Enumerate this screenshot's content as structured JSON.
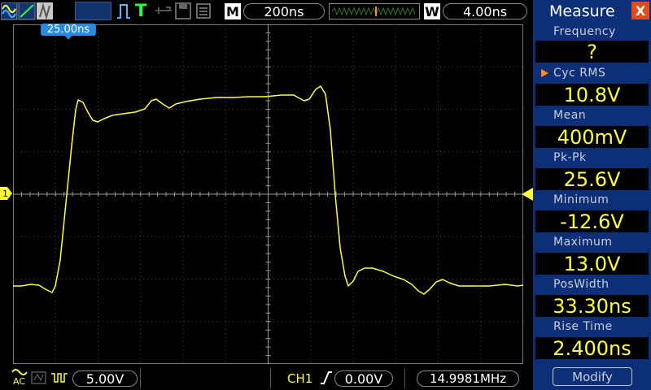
{
  "status": {
    "run_state": "T",
    "timebase_mode": "M",
    "timebase": "200ns",
    "window_mode": "W",
    "window": "4.00ns",
    "trigger_time_marker": "25.00ns"
  },
  "channel": {
    "marker": "1",
    "coupling": "AC",
    "volts_per_div": "5.00V",
    "color": "#ffff3c"
  },
  "trigger": {
    "source": "CH1",
    "level": "0.00V",
    "frequency": "14.9981MHz"
  },
  "measure": {
    "title": "Measure",
    "close_label": "X",
    "items": [
      {
        "label": "Frequency",
        "value": "?"
      },
      {
        "label": "Cyc RMS",
        "value": "10.8V"
      },
      {
        "label": "Mean",
        "value": "400mV"
      },
      {
        "label": "Pk-Pk",
        "value": "25.6V"
      },
      {
        "label": "Minimum",
        "value": "-12.6V"
      },
      {
        "label": "Maximum",
        "value": "13.0V"
      },
      {
        "label": "PosWidth",
        "value": "33.30ns"
      },
      {
        "label": "Rise Time",
        "value": "2.400ns"
      }
    ],
    "modify_label": "Modify"
  },
  "colors": {
    "panel": "#0c2f77",
    "trace": "#ffff3c",
    "accent": "#ff8c1a",
    "close": "#e24a1a"
  }
}
